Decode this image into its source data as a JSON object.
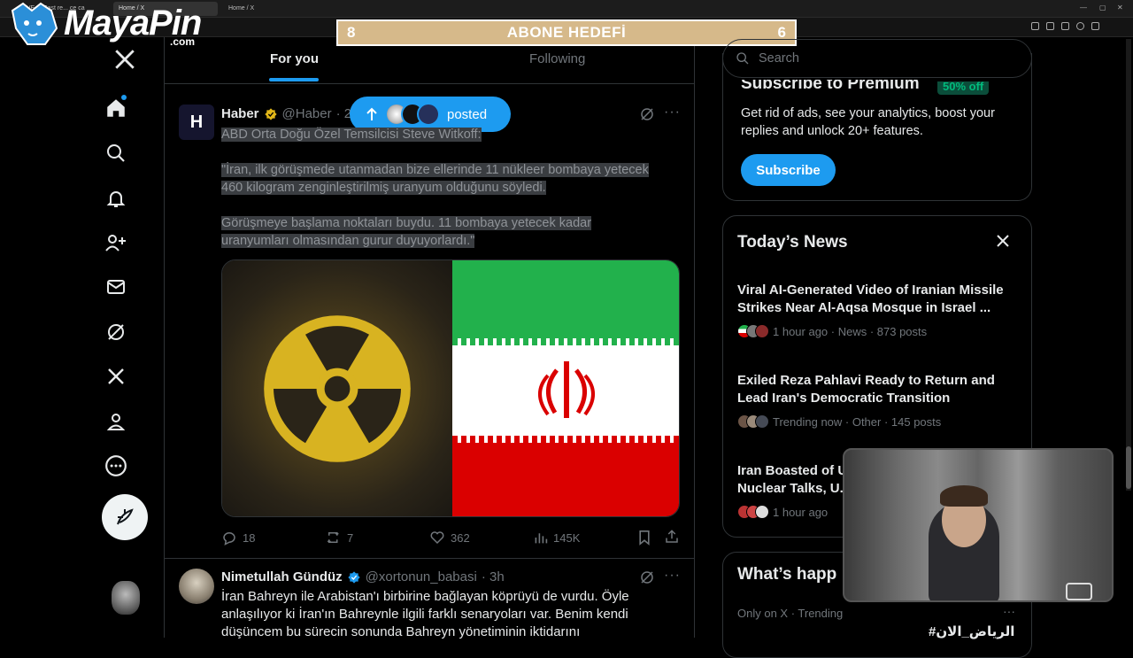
{
  "browser": {
    "tabs": [
      {
        "label": "LIVE ... East re... ce ca",
        "active": false
      },
      {
        "label": "Home / X",
        "active": true
      },
      {
        "label": "Home / X",
        "active": false
      }
    ]
  },
  "overlay": {
    "logo": {
      "brand": "MayaPin",
      "suffix": ".com"
    },
    "goal": {
      "left": "8",
      "title": "ABONE HEDEFİ",
      "right": "6"
    }
  },
  "nav": {
    "items": [
      "x-logo",
      "home",
      "explore",
      "notifications",
      "follow",
      "messages",
      "grok",
      "x-premium",
      "profile",
      "more"
    ],
    "post_button": "post"
  },
  "feed": {
    "tabs": [
      {
        "label": "For you",
        "active": true
      },
      {
        "label": "Following",
        "active": false
      }
    ],
    "new_posts_pill": {
      "label": "posted"
    },
    "posts": [
      {
        "name": "Haber",
        "handle": "@Haber",
        "time_partial": "· 2",
        "verified": true,
        "lines": [
          "ABD Orta Doğu Özel Temsilcisi Steve Witkoff:",
          "\"İran, ilk görüşmede utanmadan bize ellerinde 11 nükleer bombaya yetecek",
          "460 kilogram zenginleştirilmiş uranyum olduğunu söyledi.",
          "Görüşmeye başlama noktaları buydu. 11 bombaya yetecek kadar",
          "uranyumları olmasından gurur duyuyorlardı.\""
        ],
        "stats": {
          "replies": "18",
          "reposts": "7",
          "likes": "362",
          "views": "145K"
        }
      },
      {
        "name": "Nimetullah Gündüz",
        "handle": "@xortonun_babasi",
        "time": "· 3h",
        "verified": true,
        "lines": [
          "İran Bahreyn ile Arabistan'ı birbirine bağlayan köprüyü de vurdu. Öyle",
          "anlaşılıyor ki İran'ın Bahreynle ilgili farklı senaryoları var. Benim kendi",
          "düşüncem bu sürecin sonunda Bahreyn yönetiminin iktidarını"
        ]
      }
    ]
  },
  "sidebar": {
    "search_placeholder": "Search",
    "premium": {
      "title": "Subscribe to Premium",
      "badge": "50% off",
      "text_1": "Get rid of ads, see your analytics, boost your",
      "text_2": "replies and unlock 20+ features.",
      "button": "Subscribe"
    },
    "news": {
      "heading": "Today’s News",
      "items": [
        {
          "line1": "Viral AI-Generated Video of Iranian Missile",
          "line2": "Strikes Near Al-Aqsa Mosque in Israel ...",
          "meta": "1 hour ago · News · 873 posts"
        },
        {
          "line1": "Exiled Reza Pahlavi Ready to Return and",
          "line2": "Lead Iran's Democratic Transition",
          "meta": "Trending now · Other · 145 posts"
        },
        {
          "line1": "Iran Boasted of U",
          "line2": "Nuclear Talks, U.",
          "meta": "1 hour ago"
        }
      ]
    },
    "happening": {
      "heading": "What’s happ",
      "meta": "Only on X · Trending",
      "hashtag": "#الرياض_الان"
    }
  },
  "colors": {
    "accent": "#1d9bf0",
    "goal_bar": "#d6b98a",
    "premium_badge": "#00ba7c"
  }
}
